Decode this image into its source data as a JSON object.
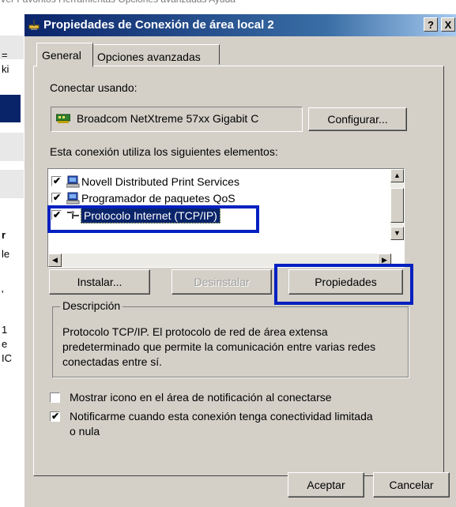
{
  "background": {
    "menu_text": "Ver    Favoritos    Herramientas    Opciones avanzadas    Ayuda",
    "side_letters": [
      "=",
      "ki",
      "r",
      "le",
      "'",
      "1",
      "e",
      "IC"
    ]
  },
  "dialog": {
    "title": "Propiedades de Conexión de área local 2",
    "help_button": "?",
    "close_button": "X",
    "tabs": [
      {
        "label": "General",
        "active": true
      },
      {
        "label": "Opciones avanzadas",
        "active": false
      }
    ],
    "connect_using_label": "Conectar usando:",
    "adapter_name": "Broadcom NetXtreme 57xx Gigabit C",
    "configure_button": "Configurar...",
    "components_label": "Esta conexión utiliza los siguientes elementos:",
    "components": [
      {
        "name": "Novell Distributed Print Services",
        "checked": true,
        "selected": false
      },
      {
        "name": "Programador de paquetes QoS",
        "checked": true,
        "selected": false
      },
      {
        "name": "Protocolo Internet (TCP/IP)",
        "checked": true,
        "selected": true
      }
    ],
    "install_button": "Instalar...",
    "uninstall_button": "Desinstalar",
    "properties_button": "Propiedades",
    "description_legend": "Descripción",
    "description_text": "Protocolo TCP/IP. El protocolo de red de área extensa predeterminado que permite la comunicación entre varias redes conectadas entre sí.",
    "show_icon_label": "Mostrar icono en el área de notificación al conectarse",
    "show_icon_checked": false,
    "notify_label_line1": "Notificarme cuando esta conexión tenga conectividad limitada",
    "notify_label_line2": "o nula",
    "notify_checked": true,
    "accept_button": "Aceptar",
    "cancel_button": "Cancelar"
  },
  "colors": {
    "annotation_highlight": "#0020c0",
    "titlebar_start": "#0a246a",
    "selection": "#0a246a"
  }
}
